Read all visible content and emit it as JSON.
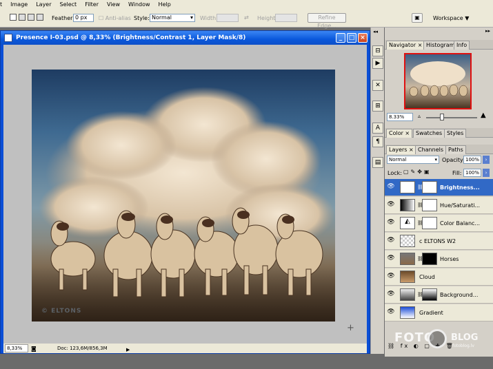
{
  "menu": [
    "t",
    "Image",
    "Layer",
    "Select",
    "Filter",
    "View",
    "Window",
    "Help"
  ],
  "options": {
    "feather_label": "Feather:",
    "feather_value": "0 px",
    "antialias_label": "Anti-alias",
    "style_label": "Style:",
    "style_value": "Normal",
    "width_label": "Width:",
    "height_label": "Height:",
    "refine_edge": "Refine Edge...",
    "workspace": "Workspace"
  },
  "document": {
    "title": "Presence I-03.psd @ 8,33% (Brightness/Contrast 1, Layer Mask/8)",
    "zoom": "8,33%",
    "doc_info": "Doc: 123,6M/856,3M",
    "watermark": "© ELTONS"
  },
  "navigator": {
    "tabs": [
      "Navigator",
      "Histogram",
      "Info"
    ],
    "zoom": "8.33%"
  },
  "color_panel": {
    "tabs": [
      "Color",
      "Swatches",
      "Styles"
    ]
  },
  "layers_panel": {
    "tabs": [
      "Layers",
      "Channels",
      "Paths"
    ],
    "blend_mode": "Normal",
    "opacity_label": "Opacity:",
    "opacity_value": "100%",
    "lock_label": "Lock:",
    "fill_label": "Fill:",
    "fill_value": "100%",
    "layers": [
      {
        "name": "Brightness..."
      },
      {
        "name": "Hue/Saturati..."
      },
      {
        "name": "Color Balanc..."
      },
      {
        "name": "c ELTONS W2"
      },
      {
        "name": "Horses"
      },
      {
        "name": "Cloud"
      },
      {
        "name": "Background..."
      },
      {
        "name": "Gradient"
      }
    ]
  },
  "branding": {
    "logo": "FOTO",
    "blog": "BLOG",
    "url": "fotoblog.lv"
  }
}
